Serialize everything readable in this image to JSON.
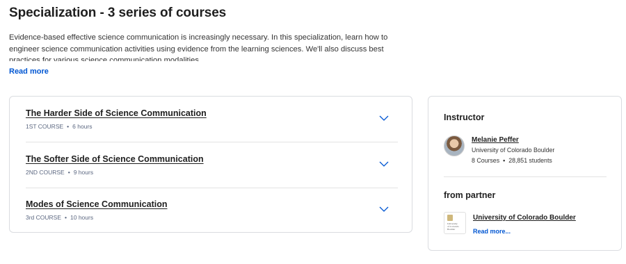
{
  "header": {
    "title": "Specialization - 3 series of courses",
    "description": "Evidence-based effective science communication is increasingly necessary. In this specialization, learn how to engineer science communication activities using evidence from the learning sciences. We'll also discuss best practices for various science communication modalities.",
    "read_more": "Read more"
  },
  "courses": [
    {
      "title": "The Harder Side of Science Communication",
      "label": "1ST COURSE",
      "duration": "6 hours"
    },
    {
      "title": "The Softer Side of Science Communication",
      "label": "2ND COURSE",
      "duration": "9 hours"
    },
    {
      "title": "Modes of Science Communication",
      "label": "3rd COURSE",
      "duration": "10 hours"
    }
  ],
  "meta_separator": "•",
  "instructor": {
    "heading": "Instructor",
    "name": "Melanie Peffer",
    "organization": "University of Colorado Boulder",
    "courses": "8 Courses",
    "students": "28,851 students"
  },
  "partner": {
    "heading": "from partner",
    "name": "University of Colorado Boulder",
    "read_more": "Read more...",
    "logo_text": [
      "University",
      "of Colorado",
      "Boulder"
    ]
  },
  "colors": {
    "link_blue": "#0056d2",
    "chevron": "#0056d2",
    "border": "#dadce0"
  },
  "icons": {
    "expand": "chevron-down-icon",
    "avatar": "avatar"
  }
}
